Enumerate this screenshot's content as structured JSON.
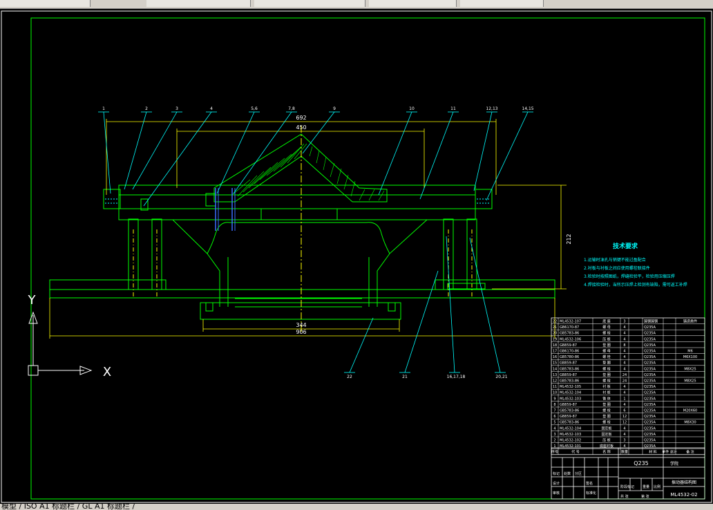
{
  "window": {
    "status_tab_text": "模型 / ISO A1 标题栏 / GL A1 标题栏 /"
  },
  "drawing": {
    "dim_692": "692",
    "dim_450": "450",
    "dim_212": "212",
    "dim_344": "344",
    "dim_906": "906",
    "callouts_top": [
      "1",
      "2",
      "3",
      "4",
      "5,6",
      "7,8",
      "9",
      "10",
      "11",
      "12,13",
      "14,15"
    ],
    "callouts_bottom": [
      "22",
      "21",
      "16,17,18",
      "20,21"
    ],
    "ucs_y": "Y",
    "ucs_x": "X"
  },
  "notes": {
    "title": "技术要求",
    "items": [
      "1.运输时油孔与销键不能过盈配合",
      "2.衬板与衬板之间应使用螺栓联接件",
      "3.检验时按照图纸，焊缝检验平，检验用压缩压焊",
      "4.焊接检验时，当所示压焊上检测有缺陷，需可返工补焊"
    ]
  },
  "bom": {
    "rows": [
      {
        "no": "22",
        "code": "ML4532-107",
        "name": "底 座",
        "qty": "3",
        "material": "铸钢铸钢",
        "note": "铸造类件"
      },
      {
        "no": "21",
        "code": "GB6170-87",
        "name": "螺 母",
        "qty": "4",
        "material": "Q235A",
        "note": ""
      },
      {
        "no": "20",
        "code": "GB5783-86",
        "name": "螺 栓",
        "qty": "4",
        "material": "Q235A",
        "note": ""
      },
      {
        "no": "19",
        "code": "ML4532-106",
        "name": "压 板",
        "qty": "4",
        "material": "Q235A",
        "note": ""
      },
      {
        "no": "18",
        "code": "GB859-87",
        "name": "垫 圈",
        "qty": "8",
        "material": "Q235A",
        "note": ""
      },
      {
        "no": "17",
        "code": "GB6170-86",
        "name": "螺 母",
        "qty": "4",
        "material": "Q235A",
        "note": "M6"
      },
      {
        "no": "16",
        "code": "GB5780-86",
        "name": "螺 栓",
        "qty": "4",
        "material": "Q235A",
        "note": "M6X100"
      },
      {
        "no": "15",
        "code": "GB859-87",
        "name": "垫 圈",
        "qty": "4",
        "material": "Q235A",
        "note": ""
      },
      {
        "no": "14",
        "code": "GB5783-86",
        "name": "螺 栓",
        "qty": "4",
        "material": "Q235A",
        "note": "M8X25"
      },
      {
        "no": "13",
        "code": "GB859-87",
        "name": "垫 圈",
        "qty": "24",
        "material": "Q235A",
        "note": ""
      },
      {
        "no": "12",
        "code": "GB5783-86",
        "name": "螺 栓",
        "qty": "24",
        "material": "Q235A",
        "note": "M8X25"
      },
      {
        "no": "11",
        "code": "ML4532-105",
        "name": "衬 板",
        "qty": "4",
        "material": "Q235A",
        "note": ""
      },
      {
        "no": "10",
        "code": "ML4532-104",
        "name": "衬 板",
        "qty": "4",
        "material": "Q235A",
        "note": ""
      },
      {
        "no": "9",
        "code": "ML4532-103",
        "name": "锥 体",
        "qty": "1",
        "material": "Q235A",
        "note": ""
      },
      {
        "no": "8",
        "code": "GB859-87",
        "name": "垫 圈",
        "qty": "4",
        "material": "Q235A",
        "note": ""
      },
      {
        "no": "7",
        "code": "GB5783-86",
        "name": "螺 栓",
        "qty": "6",
        "material": "Q235A",
        "note": "M20X60"
      },
      {
        "no": "6",
        "code": "GB859-87",
        "name": "垫 圈",
        "qty": "12",
        "material": "Q235A",
        "note": ""
      },
      {
        "no": "5",
        "code": "GB5783-86",
        "name": "螺 栓",
        "qty": "12",
        "material": "Q235A",
        "note": "M8X30"
      },
      {
        "no": "4",
        "code": "ML4532-104",
        "name": "固定板",
        "qty": "4",
        "material": "Q235A",
        "note": ""
      },
      {
        "no": "3",
        "code": "ML4532-103",
        "name": "固定板",
        "qty": "4",
        "material": "Q235A",
        "note": ""
      },
      {
        "no": "2",
        "code": "ML4532-102",
        "name": "压 板",
        "qty": "3",
        "material": "Q235A",
        "note": ""
      },
      {
        "no": "1",
        "code": "ML4532-101",
        "name": "底座衬板",
        "qty": "4",
        "material": "Q235A",
        "note": ""
      }
    ],
    "header": {
      "no": "序号",
      "code": "代 号",
      "name": "名 称",
      "qty": "数量",
      "material": "材 料",
      "weight": "单件 总计",
      "note": "备 注"
    }
  },
  "title_block": {
    "material": "Q235",
    "company": "学院",
    "drawing_name": "振动器结构图",
    "drawing_number": "ML4532-02",
    "row_labels": [
      "标记",
      "处数",
      "分区",
      "更改文件号",
      "签名",
      "年月日"
    ],
    "row_labels2": [
      "设计",
      "标准化",
      "审核",
      "工艺",
      "批准"
    ],
    "stage_labels": [
      "阶段标记",
      "重量",
      "比例"
    ],
    "sheet_labels": [
      "共 张",
      "第 张"
    ]
  },
  "colors": {
    "geometry": "#00ff00",
    "dim": "#ffff00",
    "leader": "#00ffff",
    "text_white": "#ffffff",
    "hatch": "#00ff00",
    "center": "#ffff00",
    "bolt": "#3b6cff"
  }
}
